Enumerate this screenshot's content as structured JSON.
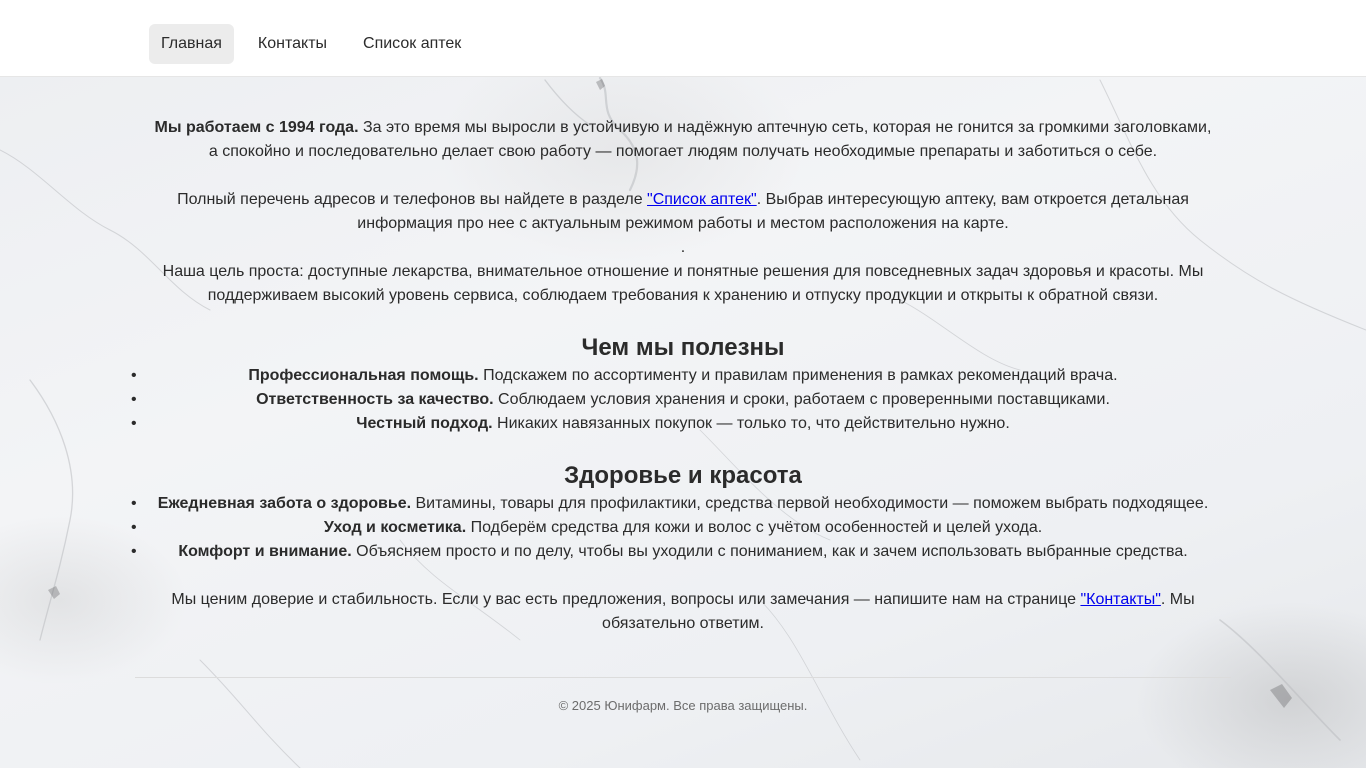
{
  "nav": {
    "items": [
      {
        "label": "Главная",
        "active": true
      },
      {
        "label": "Контакты",
        "active": false
      },
      {
        "label": "Список аптек",
        "active": false
      }
    ]
  },
  "intro": {
    "p1_bold": "Мы работаем с 1994 года.",
    "p1_text": " За это время мы выросли в устойчивую и надёжную аптечную сеть, которая не гонится за громкими заголовками, а спокойно и последовательно делает свою работу — помогает людям получать необходимые препараты и заботиться о себе.",
    "p2_before": "Полный перечень адресов и телефонов вы найдете в разделе ",
    "p2_link": "\"Список аптек\"",
    "p2_after": ". Выбрав интересующую аптеку, вам откроется детальная информация про нее с актуальным режимом работы и местом расположения на карте.",
    "dot": ".",
    "p3": "Наша цель проста: доступные лекарства, внимательное отношение и понятные решения для повседневных задач здоровья и красоты. Мы поддерживаем высокий уровень сервиса, соблюдаем требования к хранению и отпуску продукции и открыты к обратной связи."
  },
  "section1": {
    "title": "Чем мы полезны",
    "items": [
      {
        "bold": "Профессиональная помощь.",
        "text": " Подскажем по ассортименту и правилам применения в рамках рекомендаций врача."
      },
      {
        "bold": "Ответственность за качество.",
        "text": " Соблюдаем условия хранения и сроки, работаем с проверенными поставщиками."
      },
      {
        "bold": "Честный подход.",
        "text": " Никаких навязанных покупок — только то, что действительно нужно."
      }
    ]
  },
  "section2": {
    "title": "Здоровье и красота",
    "items": [
      {
        "bold": "Ежедневная забота о здоровье.",
        "text": " Витамины, товары для профилактики, средства первой необходимости — поможем выбрать подходящее."
      },
      {
        "bold": "Уход и косметика.",
        "text": " Подберём средства для кожи и волос с учётом особенностей и целей ухода."
      },
      {
        "bold": "Комфорт и внимание.",
        "text": " Объясняем просто и по делу, чтобы вы уходили с пониманием, как и зачем использовать выбранные средства."
      }
    ]
  },
  "closing": {
    "before": "Мы ценим доверие и стабильность. Если у вас есть предложения, вопросы или замечания — напишите нам на странице ",
    "link": "\"Контакты\"",
    "after": ". Мы обязательно ответим."
  },
  "bullet": "•",
  "footer": {
    "text": "© 2025 Юнифарм. Все права защищены."
  },
  "colors": {
    "link": "#0000ee",
    "nav_active_bg": "#ececec",
    "text": "#2b2b2b"
  }
}
